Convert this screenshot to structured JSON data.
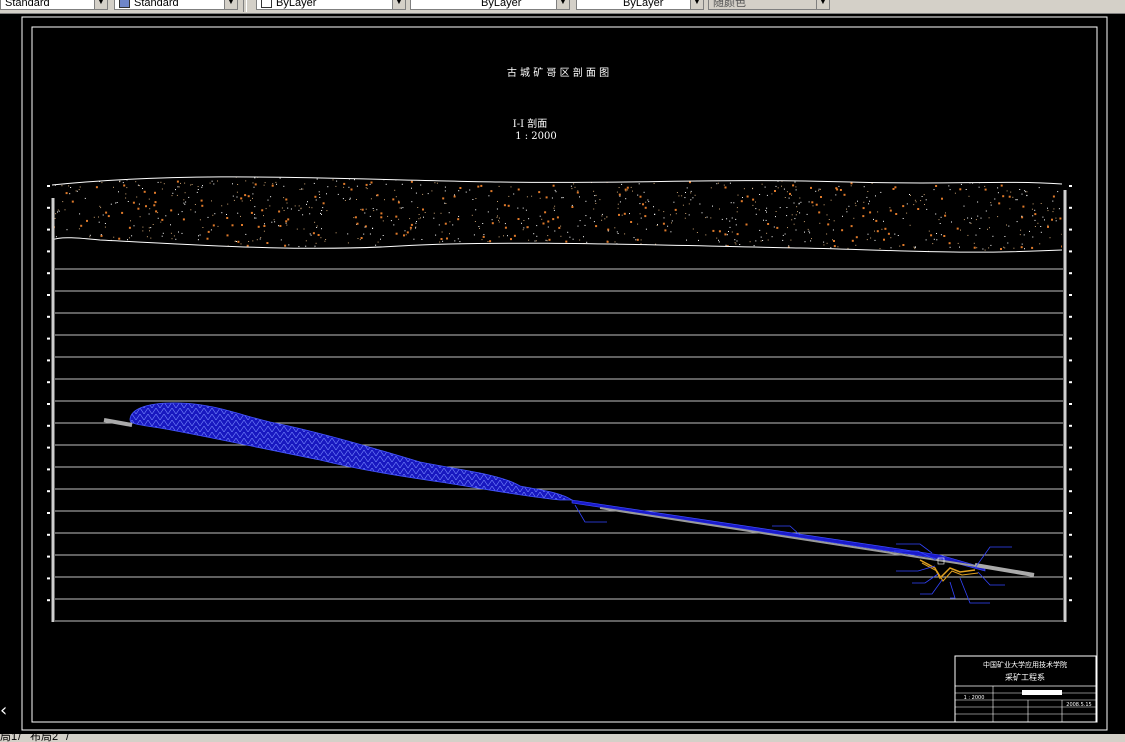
{
  "toolbar": {
    "textstyle": "Standard",
    "dimstyle": "Standard",
    "layer_color": "ByLayer",
    "linetype": "ByLayer",
    "lineweight": "ByLayer",
    "plotstyle": "随颜色"
  },
  "drawing": {
    "main_title": "古 城  矿 哥 区 剖 面 图",
    "section_title": "I-I 剖面",
    "scale": "1 : 2000",
    "colors": {
      "background": "#000000",
      "frame": "#ffffff",
      "orebody": "#1a1acc",
      "orebody_pattern": "#6677ff",
      "topsoil_dots": "#e07a2a",
      "shaft": "#aaaaaa",
      "roadway": "#e0a020"
    }
  },
  "title_block": {
    "school": "中国矿业大学应用技术学院",
    "department": "采矿工程系",
    "scale": "1 : 2000",
    "date": "2008.5.15"
  },
  "layout_tabs": [
    "局1",
    "布局2"
  ]
}
